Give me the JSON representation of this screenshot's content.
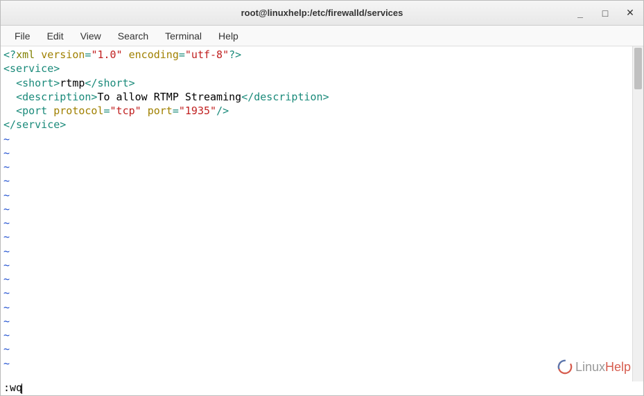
{
  "titlebar": {
    "title": "root@linuxhelp:/etc/firewalld/services"
  },
  "menubar": {
    "items": [
      "File",
      "Edit",
      "View",
      "Search",
      "Terminal",
      "Help"
    ]
  },
  "editor": {
    "lines": [
      [
        {
          "cls": "tag",
          "t": "<?"
        },
        {
          "cls": "decl",
          "t": "xml"
        },
        {
          "cls": "text",
          "t": " "
        },
        {
          "cls": "attr",
          "t": "version"
        },
        {
          "cls": "tag",
          "t": "="
        },
        {
          "cls": "string",
          "t": "\"1.0\""
        },
        {
          "cls": "text",
          "t": " "
        },
        {
          "cls": "attr",
          "t": "encoding"
        },
        {
          "cls": "tag",
          "t": "="
        },
        {
          "cls": "string",
          "t": "\"utf-8\""
        },
        {
          "cls": "tag",
          "t": "?>"
        }
      ],
      [
        {
          "cls": "tag",
          "t": "<service>"
        }
      ],
      [
        {
          "cls": "text",
          "t": "  "
        },
        {
          "cls": "tag",
          "t": "<short>"
        },
        {
          "cls": "text",
          "t": "rtmp"
        },
        {
          "cls": "tag",
          "t": "</short>"
        }
      ],
      [
        {
          "cls": "text",
          "t": "  "
        },
        {
          "cls": "tag",
          "t": "<description>"
        },
        {
          "cls": "text",
          "t": "To allow RTMP Streaming"
        },
        {
          "cls": "tag",
          "t": "</description>"
        }
      ],
      [
        {
          "cls": "text",
          "t": "  "
        },
        {
          "cls": "tag",
          "t": "<"
        },
        {
          "cls": "tag",
          "t": "port"
        },
        {
          "cls": "text",
          "t": " "
        },
        {
          "cls": "attr",
          "t": "protocol"
        },
        {
          "cls": "tag",
          "t": "="
        },
        {
          "cls": "string",
          "t": "\"tcp\""
        },
        {
          "cls": "text",
          "t": " "
        },
        {
          "cls": "attr",
          "t": "port"
        },
        {
          "cls": "tag",
          "t": "="
        },
        {
          "cls": "string",
          "t": "\"1935\""
        },
        {
          "cls": "tag",
          "t": "/>"
        }
      ],
      [
        {
          "cls": "tag",
          "t": "</service>"
        }
      ]
    ],
    "tilde_count": 17,
    "tilde_char": "~",
    "status": ":wq"
  },
  "watermark": {
    "text_prefix": "Linux",
    "text_suffix": "Help"
  }
}
